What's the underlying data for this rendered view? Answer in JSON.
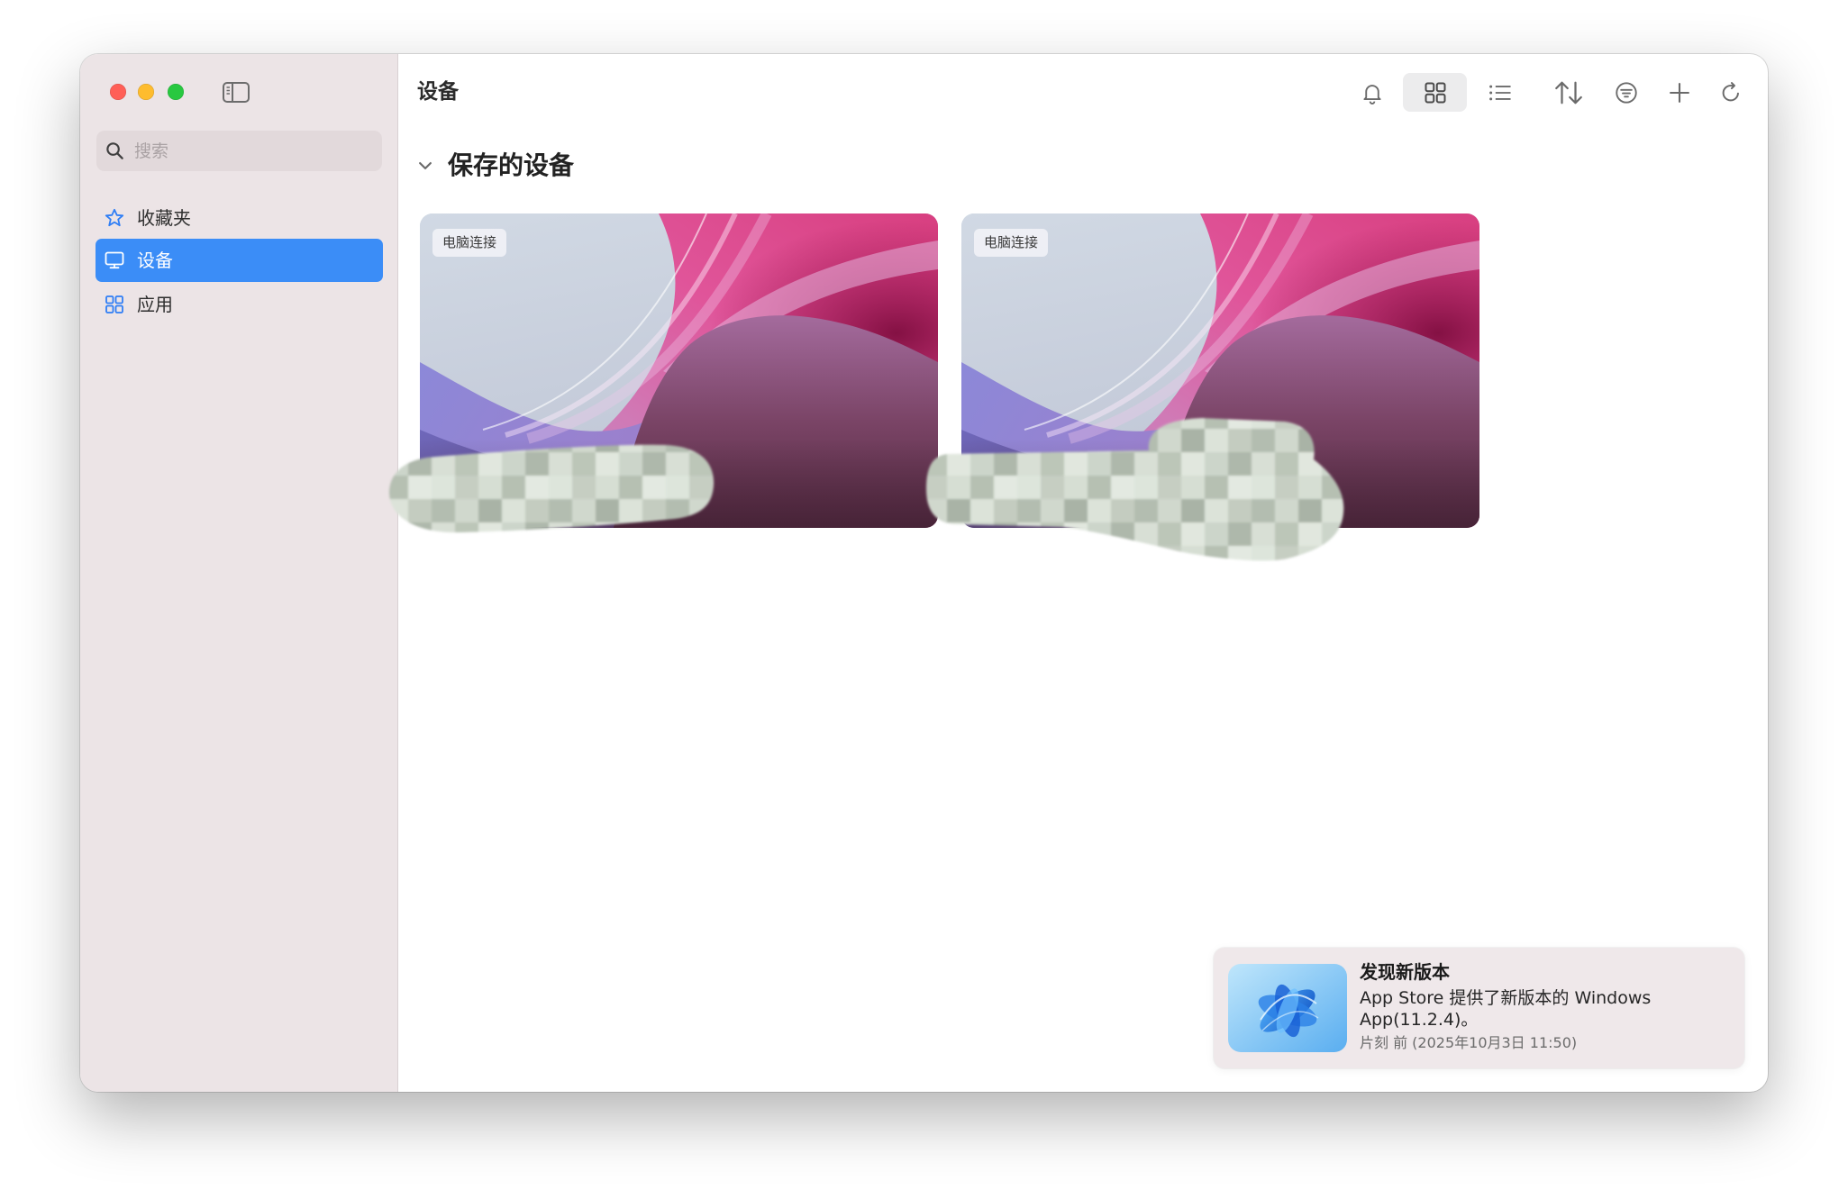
{
  "colors": {
    "accent": "#3b8df7",
    "sidebar_bg": "#ece4e6",
    "close": "#ff5f57",
    "minimize": "#febc2e",
    "zoom": "#28c840",
    "icon_blue": "#2f7ef5"
  },
  "window": {
    "controls": [
      "close",
      "minimize",
      "zoom"
    ],
    "sidebar_toggle_icon": "sidebar-left-icon"
  },
  "sidebar": {
    "search": {
      "placeholder": "搜索",
      "value": "",
      "icon": "search-icon"
    },
    "items": [
      {
        "label": "收藏夹",
        "icon": "star-icon",
        "selected": false
      },
      {
        "label": "设备",
        "icon": "monitor-icon",
        "selected": true
      },
      {
        "label": "应用",
        "icon": "apps-grid-icon",
        "selected": false
      }
    ]
  },
  "toolbar": {
    "title": "设备",
    "buttons": [
      {
        "icon": "bell-icon",
        "active": false
      },
      {
        "icon": "grid-view-icon",
        "active": true
      },
      {
        "icon": "list-view-icon",
        "active": false
      },
      {
        "icon": "sort-icon",
        "active": false
      },
      {
        "icon": "filter-icon",
        "active": false
      },
      {
        "icon": "plus-icon",
        "active": false
      },
      {
        "icon": "refresh-icon",
        "active": false
      }
    ]
  },
  "section": {
    "title": "保存的设备",
    "expanded": true,
    "icon": "chevron-down-icon"
  },
  "devices": [
    {
      "badge": "电脑连接"
    },
    {
      "badge": "电脑连接"
    }
  ],
  "notification": {
    "icon": "windows-app-icon",
    "title": "发现新版本",
    "body": "App Store 提供了新版本的 Windows App(11.2.4)。",
    "time": "片刻 前 (2025年10月3日 11:50)"
  }
}
